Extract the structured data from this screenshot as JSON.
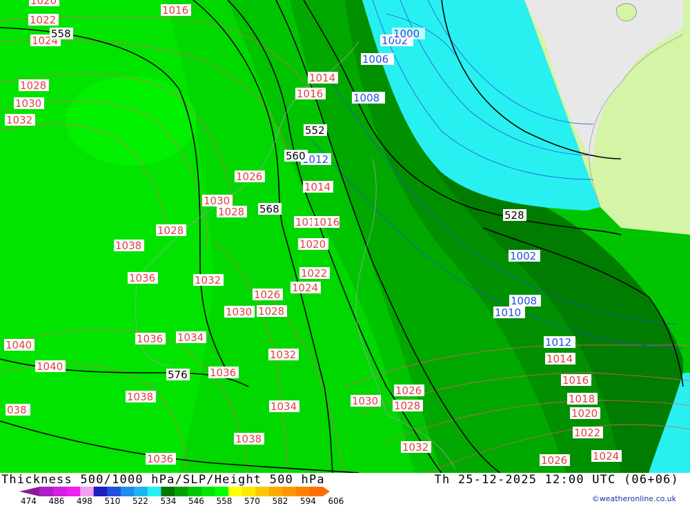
{
  "title": "Thickness 500/1000 hPa/SLP/Height 500 hPa",
  "datetime": "Th 25-12-2025 12:00 UTC (06+06)",
  "credit": "©weatheronline.co.uk",
  "colorbar": {
    "ticks": [
      "474",
      "486",
      "498",
      "510",
      "522",
      "534",
      "546",
      "558",
      "570",
      "582",
      "594",
      "606"
    ],
    "colors": [
      "#8b1a9a",
      "#b01ec8",
      "#d41ee0",
      "#f01ef0",
      "#f0a0f0",
      "#1e1ebe",
      "#1e50dc",
      "#1e8cf0",
      "#1eb4f0",
      "#28f0f0",
      "#007800",
      "#00a000",
      "#00c800",
      "#00e600",
      "#00ff00",
      "#ffff00",
      "#ffe600",
      "#ffc800",
      "#ffaa00",
      "#ff9600",
      "#ff8200",
      "#ff6e00"
    ]
  },
  "colors": {
    "slp_contour": "#e06060",
    "height_contour": "#000000",
    "low_contour": "#2050e0",
    "land": "#d4f4a6",
    "ice": "#e8e8e8"
  },
  "labels": {
    "slp": [
      "1020",
      "1016",
      "1022",
      "1024",
      "1028",
      "1030",
      "1032",
      "1026",
      "1030",
      "1028",
      "1028",
      "1038",
      "1036",
      "1032",
      "1026",
      "1028",
      "1030",
      "1040",
      "1036",
      "1034",
      "1040",
      "1032",
      "1036",
      "1038",
      "1038",
      "1034",
      "1030",
      "1026",
      "1028",
      "1032",
      "1036",
      "1014",
      "1016",
      "1014",
      "1018",
      "1016",
      "1020",
      "1022",
      "1024",
      "038",
      "1024",
      "1014",
      "1016",
      "1018",
      "1020",
      "1022",
      "1026",
      "1024"
    ],
    "low": [
      "1006",
      "1008",
      "1012",
      "1002",
      "1008",
      "1010",
      "1012",
      "1002",
      "1000"
    ],
    "height": [
      "558",
      "552",
      "560",
      "568",
      "528",
      "576"
    ]
  }
}
